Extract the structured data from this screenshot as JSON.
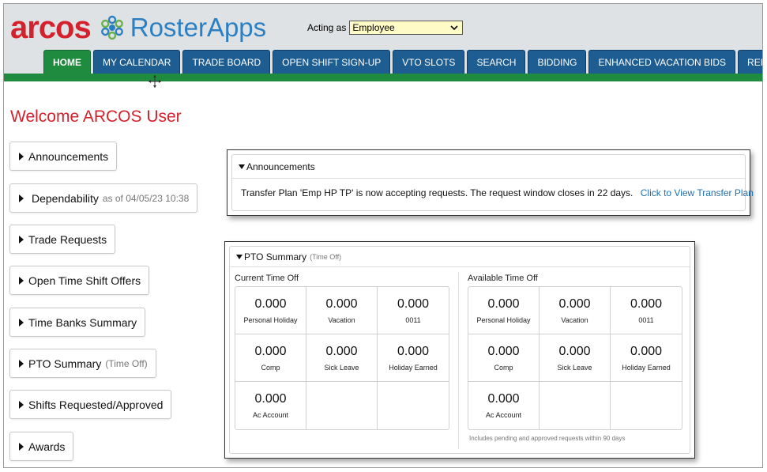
{
  "header": {
    "logo_arcos": "arcos",
    "logo_roster": "RosterApps",
    "acting_label": "Acting as",
    "acting_value": "Employee"
  },
  "nav": {
    "tabs": [
      {
        "label": "HOME",
        "active": true
      },
      {
        "label": "MY CALENDAR"
      },
      {
        "label": "TRADE BOARD"
      },
      {
        "label": "OPEN SHIFT SIGN-UP"
      },
      {
        "label": "VTO SLOTS"
      },
      {
        "label": "SEARCH"
      },
      {
        "label": "BIDDING"
      },
      {
        "label": "ENHANCED VACATION BIDS"
      },
      {
        "label": "REPORTS"
      }
    ]
  },
  "welcome": "Welcome ARCOS User",
  "sidebar": {
    "items": [
      {
        "label": "Announcements"
      },
      {
        "label": "Dependability",
        "sub": "as of 04/05/23 10:38"
      },
      {
        "label": "Trade Requests"
      },
      {
        "label": "Open Time Shift Offers"
      },
      {
        "label": "Time Banks Summary"
      },
      {
        "label": "PTO Summary",
        "sub": "(Time Off)"
      },
      {
        "label": "Shifts Requested/Approved"
      },
      {
        "label": "Awards"
      }
    ]
  },
  "announcements": {
    "title": "Announcements",
    "message": "Transfer Plan 'Emp HP TP' is now accepting requests. The request window closes in 22 days.",
    "link": "Click to View Transfer Plan"
  },
  "pto": {
    "title": "PTO Summary",
    "subtitle": "(Time Off)",
    "current": {
      "title": "Current Time Off",
      "cells": [
        {
          "value": "0.000",
          "label": "Personal Holiday"
        },
        {
          "value": "0.000",
          "label": "Vacation"
        },
        {
          "value": "0.000",
          "label": "0011"
        },
        {
          "value": "0.000",
          "label": "Comp"
        },
        {
          "value": "0.000",
          "label": "Sick Leave"
        },
        {
          "value": "0.000",
          "label": "Holiday Earned"
        },
        {
          "value": "0.000",
          "label": "Ac Account"
        }
      ]
    },
    "available": {
      "title": "Available Time Off",
      "cells": [
        {
          "value": "0.000",
          "label": "Personal Holiday"
        },
        {
          "value": "0.000",
          "label": "Vacation"
        },
        {
          "value": "0.000",
          "label": "0011"
        },
        {
          "value": "0.000",
          "label": "Comp"
        },
        {
          "value": "0.000",
          "label": "Sick Leave"
        },
        {
          "value": "0.000",
          "label": "Holiday Earned"
        },
        {
          "value": "0.000",
          "label": "Ac Account"
        }
      ],
      "note": "Includes pending and approved requests within 90 days"
    }
  },
  "colors": {
    "brand_red": "#d3212d",
    "brand_blue": "#2b7fc3",
    "nav_blue": "#1d5d92",
    "nav_green": "#1e8b3f",
    "link_blue": "#1e6fb3",
    "select_bg": "#fffbc7"
  }
}
